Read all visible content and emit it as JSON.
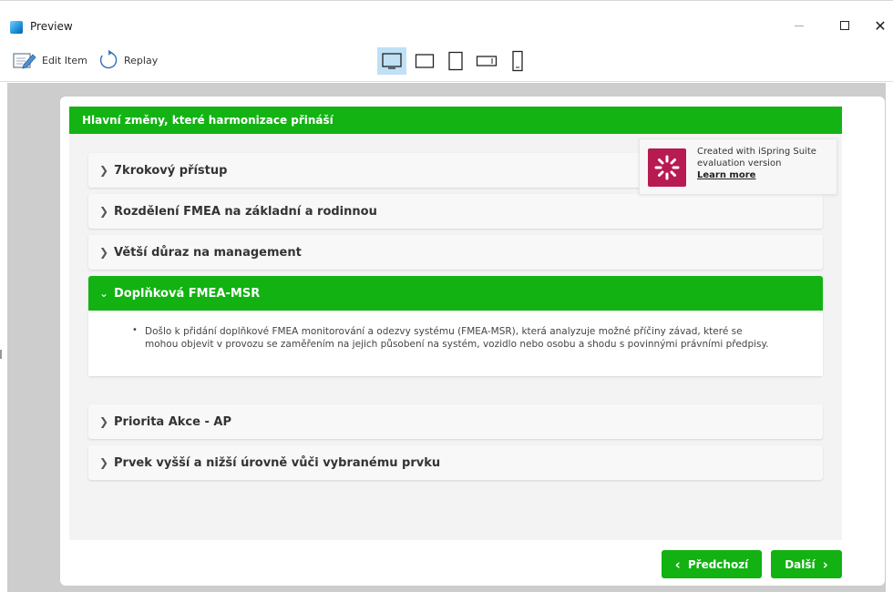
{
  "window": {
    "title": "Preview"
  },
  "toolbar": {
    "edit_label": "Edit Item",
    "replay_label": "Replay",
    "devices": [
      "desktop-icon",
      "tablet-landscape-icon",
      "tablet-portrait-icon",
      "phone-landscape-icon",
      "phone-portrait-icon"
    ],
    "active_device": "desktop"
  },
  "slide": {
    "header": "Hlavní změny, které harmonizace přináší",
    "accordion": [
      {
        "label": "7krokový přístup",
        "open": false
      },
      {
        "label": "Rozdělení FMEA na základní a rodinnou",
        "open": false
      },
      {
        "label": "Větší důraz na management",
        "open": false
      },
      {
        "label": "Doplňková FMEA-MSR",
        "open": true,
        "content": "Došlo k přidání doplňkové FMEA monitorování a odezvy systému (FMEA-MSR), která analyzuje možné příčiny závad, které se mohou objevit v provozu se zaměřením na jejich působení na systém, vozidlo nebo osobu a shodu s povinnými právními předpisy."
      },
      {
        "label": "Priorita Akce - AP",
        "open": false
      },
      {
        "label": "Prvek vyšší a nižší úrovně vůči vybranému prvku",
        "open": false
      }
    ],
    "prev_label": "Předchozí",
    "next_label": "Další",
    "prev_chevron": "‹",
    "next_chevron": "›"
  },
  "badge": {
    "line1": "Created with iSpring Suite",
    "line2": "evaluation version",
    "link": "Learn more"
  },
  "colors": {
    "accent_green": "#11b211",
    "badge_magenta": "#b81a52",
    "active_device_bg": "#bfe0f5"
  }
}
